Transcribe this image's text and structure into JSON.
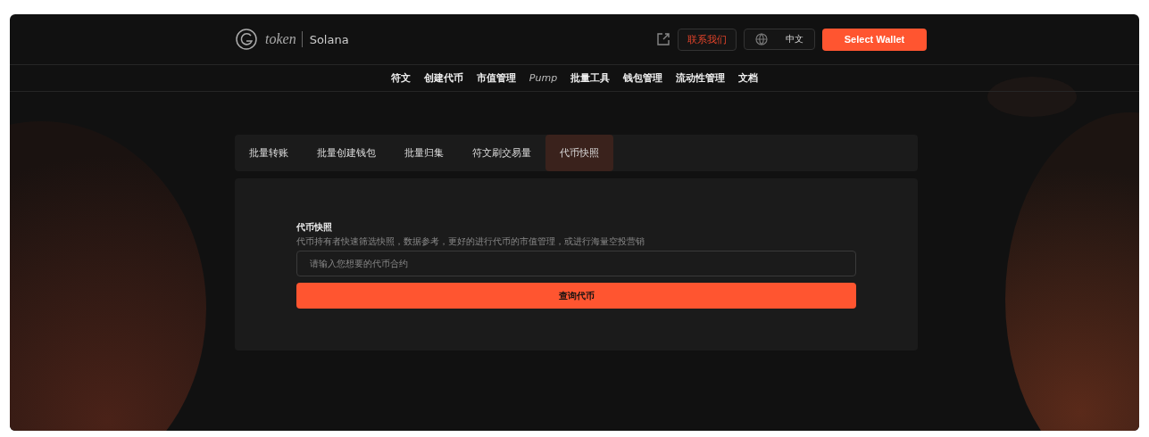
{
  "header": {
    "logo_text": "token",
    "network": "Solana",
    "contact_button": "联系我们",
    "language": "中文",
    "wallet_button": "Select Wallet"
  },
  "nav": [
    {
      "label": "符文",
      "italic": false
    },
    {
      "label": "创建代币",
      "italic": false
    },
    {
      "label": "市值管理",
      "italic": false
    },
    {
      "label": "Pump",
      "italic": true
    },
    {
      "label": "批量工具",
      "italic": false
    },
    {
      "label": "钱包管理",
      "italic": false
    },
    {
      "label": "流动性管理",
      "italic": false
    },
    {
      "label": "文档",
      "italic": false
    }
  ],
  "tabs": [
    {
      "label": "批量转账",
      "selected": false
    },
    {
      "label": "批量创建钱包",
      "selected": false
    },
    {
      "label": "批量归集",
      "selected": false
    },
    {
      "label": "符文刷交易量",
      "selected": false
    },
    {
      "label": "代币快照",
      "selected": true
    }
  ],
  "form": {
    "title": "代币快照",
    "description": "代币持有者快速筛选快照，数据参考，更好的进行代币的市值管理，或进行海量空投营销",
    "placeholder": "请输入您想要的代币合约",
    "submit": "查询代币"
  }
}
